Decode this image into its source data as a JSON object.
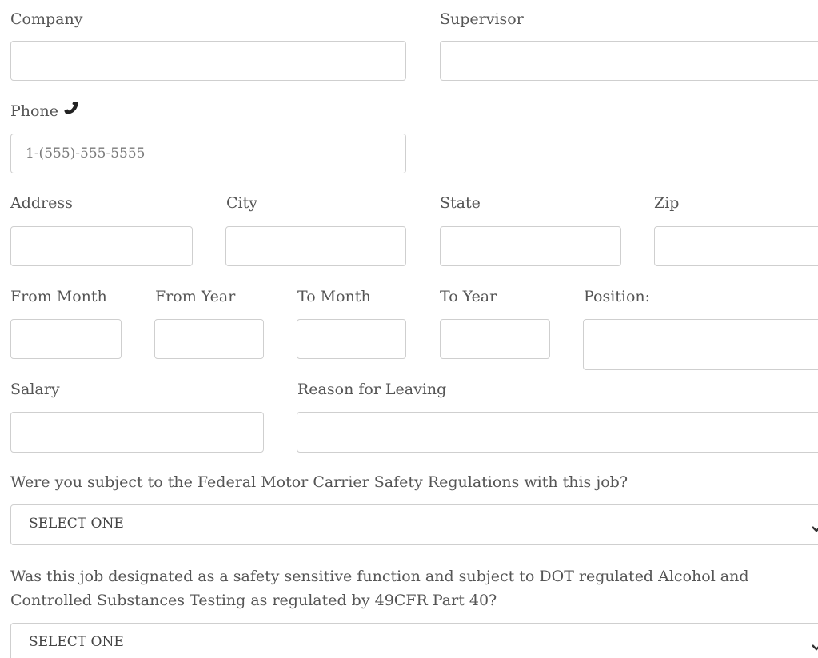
{
  "form": {
    "company": {
      "label": "Company",
      "value": ""
    },
    "supervisor": {
      "label": "Supervisor",
      "value": ""
    },
    "phone": {
      "label": "Phone",
      "placeholder": "1-(555)-555-5555",
      "value": ""
    },
    "address": {
      "label": "Address",
      "value": ""
    },
    "city": {
      "label": "City",
      "value": ""
    },
    "state": {
      "label": "State",
      "value": ""
    },
    "zip": {
      "label": "Zip",
      "value": ""
    },
    "from_month": {
      "label": "From Month",
      "value": ""
    },
    "from_year": {
      "label": "From Year",
      "value": ""
    },
    "to_month": {
      "label": "To Month",
      "value": ""
    },
    "to_year": {
      "label": "To Year",
      "value": ""
    },
    "position": {
      "label": "Position:",
      "value": ""
    },
    "salary": {
      "label": "Salary",
      "value": ""
    },
    "reason": {
      "label": "Reason for Leaving",
      "value": ""
    },
    "fmcsr": {
      "question": "Were you subject to the Federal Motor Carrier Safety Regulations with this job?",
      "selected": "SELECT ONE"
    },
    "dot": {
      "question": "Was this job designated as a safety sensitive function and subject to DOT regulated Alcohol and Controlled Substances Testing as regulated by 49CFR Part 40?",
      "selected": "SELECT ONE"
    }
  },
  "icons": {
    "phone": "phone-icon",
    "select_arrow": "chevron-down-icon"
  },
  "colors": {
    "text": "#555555",
    "border": "#cfcfcf",
    "background": "#ffffff"
  }
}
